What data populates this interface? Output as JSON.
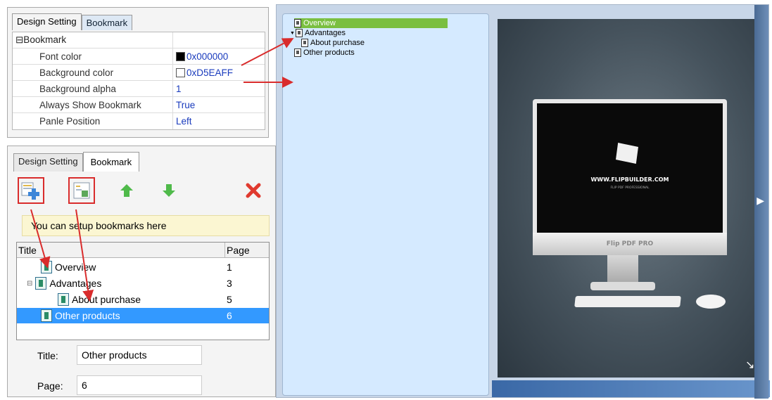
{
  "top_panel": {
    "tabs": [
      {
        "label": "Design Setting"
      },
      {
        "label": "Bookmark"
      }
    ],
    "group_label": "⊟Bookmark",
    "rows": [
      {
        "name": "Font color",
        "value": "0x000000",
        "swatch": "#000000"
      },
      {
        "name": "Background color",
        "value": "0xD5EAFF",
        "swatch": "#ffffff"
      },
      {
        "name": "Background alpha",
        "value": "1"
      },
      {
        "name": "Always Show Bookmark",
        "value": "True"
      },
      {
        "name": "Panle Position",
        "value": "Left"
      }
    ]
  },
  "bottom_panel": {
    "tabs": [
      {
        "label": "Design Setting"
      },
      {
        "label": "Bookmark"
      }
    ],
    "toolbar": {
      "add_icon": "add-bookmark-icon",
      "add_child_icon": "add-child-bookmark-icon",
      "up_icon": "arrow-up-icon",
      "down_icon": "arrow-down-icon",
      "delete_icon": "delete-icon"
    },
    "hint": "You can setup bookmarks here",
    "tree": {
      "columns": [
        "Title",
        "Page"
      ],
      "rows": [
        {
          "title": "Overview",
          "page": "1"
        },
        {
          "title": "Advantages",
          "page": "3"
        },
        {
          "title": "About purchase",
          "page": "5"
        },
        {
          "title": "Other products",
          "page": "6"
        }
      ]
    },
    "fields": {
      "title_label": "Title:",
      "title_value": "Other products",
      "page_label": "Page:",
      "page_value": "6"
    }
  },
  "preview": {
    "bookmarks": [
      {
        "label": "Overview"
      },
      {
        "label": "Advantages"
      },
      {
        "label": "About purchase"
      },
      {
        "label": "Other products"
      }
    ],
    "screen_text_1": "WWW.FLIPBUILDER.COM",
    "screen_text_2": "FLIP PDF PROFESSIONAL",
    "monitor_label": "Flip PDF PRO",
    "next_arrow": "▶"
  },
  "colors": {
    "bookmark_bg": "#D5EAFF",
    "annotation_red": "#d92c2c",
    "selection_blue": "#3399ff"
  }
}
